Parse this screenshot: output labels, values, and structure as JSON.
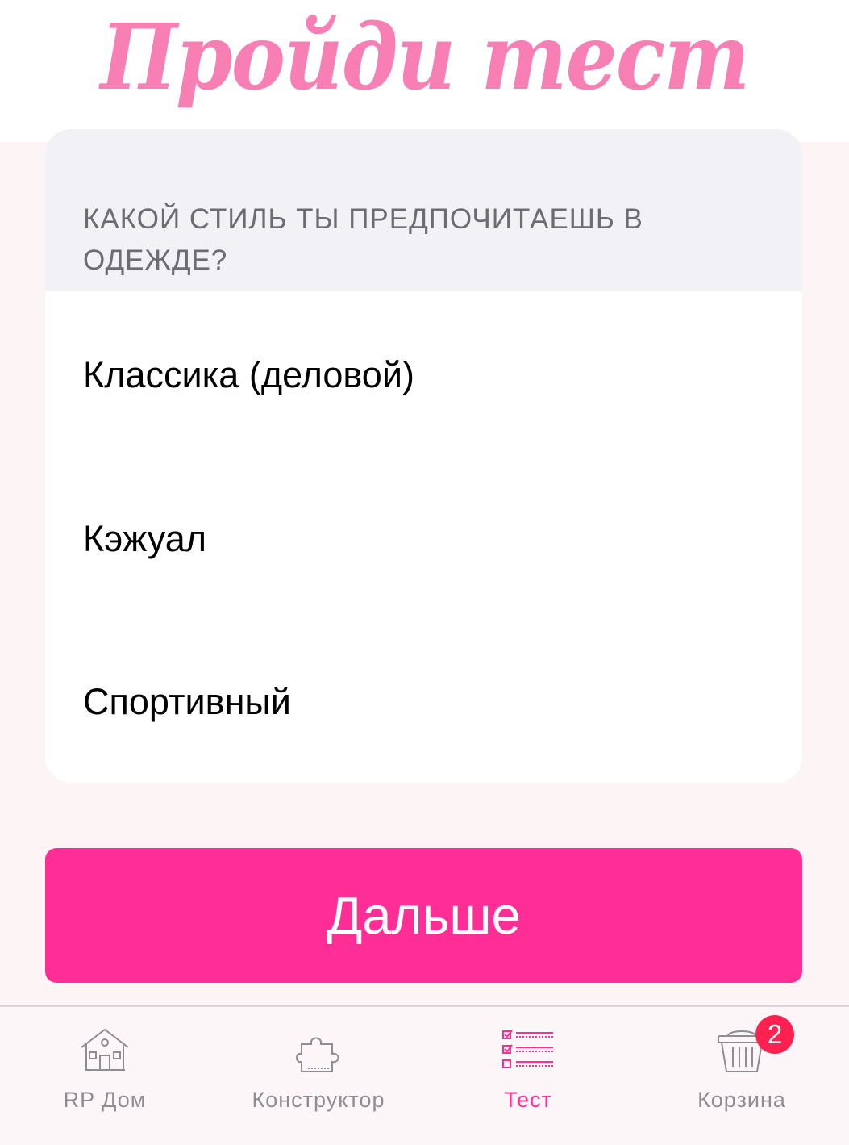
{
  "header": {
    "title": "Пройди тест"
  },
  "quiz": {
    "question": "КАКОЙ СТИЛЬ ТЫ ПРЕДПОЧИТАЕШЬ В ОДЕЖДЕ?",
    "options": [
      {
        "label": "Классика (деловой)"
      },
      {
        "label": "Кэжуал"
      },
      {
        "label": "Спортивный"
      }
    ]
  },
  "actions": {
    "next_label": "Дальше"
  },
  "tabbar": {
    "items": [
      {
        "label": "RP Дом",
        "icon": "house-icon",
        "active": false
      },
      {
        "label": "Конструктор",
        "icon": "puzzle-icon",
        "active": false
      },
      {
        "label": "Тест",
        "icon": "checklist-icon",
        "active": true
      },
      {
        "label": "Корзина",
        "icon": "basket-icon",
        "active": false,
        "badge": "2"
      }
    ]
  },
  "colors": {
    "accent": "#ff2d96",
    "title_pink": "#f77fb4",
    "badge_red": "#ff2250",
    "inactive_gray": "#8e8d93"
  }
}
